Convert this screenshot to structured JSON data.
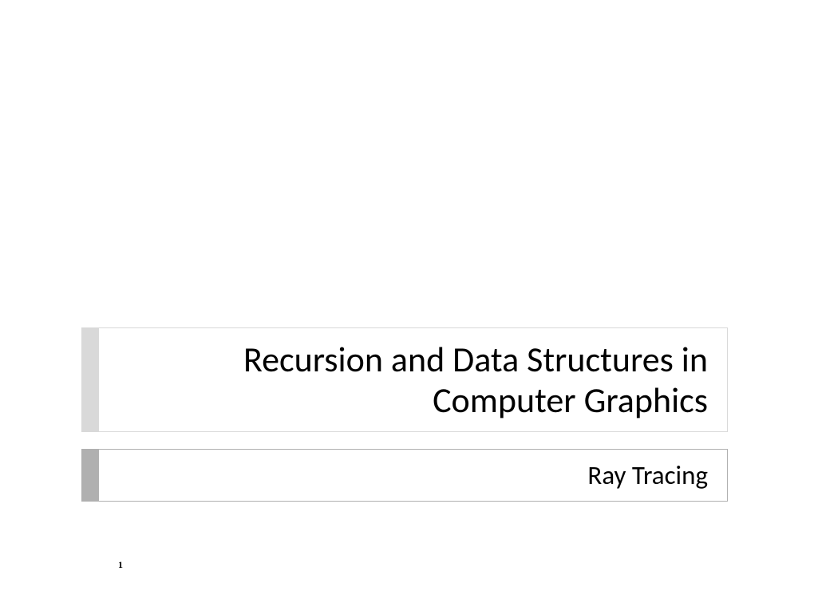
{
  "slide": {
    "title": "Recursion and Data Structures in Computer Graphics",
    "subtitle": "Ray Tracing",
    "pageNumber": "1"
  }
}
